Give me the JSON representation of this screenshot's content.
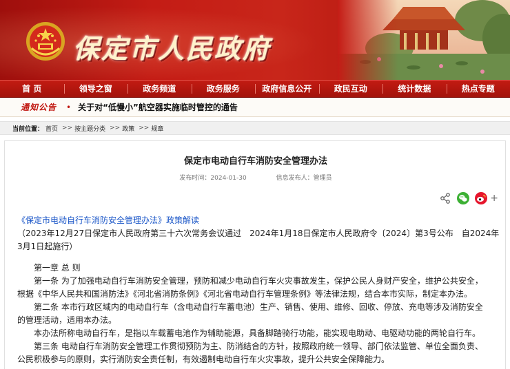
{
  "header": {
    "site_title": "保定市人民政府"
  },
  "nav": {
    "items": [
      "首 页",
      "领导之窗",
      "政务频道",
      "政务服务",
      "政府信息公开",
      "政民互动",
      "统计数据",
      "热点专题"
    ]
  },
  "notice": {
    "label": "通知公告",
    "dot": "•",
    "text": "关于对“低慢小”航空器实施临时管控的通告"
  },
  "breadcrumb": {
    "label": "当前位置：",
    "items": [
      "首页",
      "按主题分类",
      "政策",
      "规章"
    ],
    "separator": ">>"
  },
  "article": {
    "title": "保定市电动自行车消防安全管理办法",
    "publish_time": "发布时间：2024-01-30",
    "publisher": "信息发布人：管理员",
    "interpretation_link": "《保定市电动自行车消防安全管理办法》政策解读",
    "adoption_line1": "（2023年12月27日保定市人民政府第三十六次常务会议通过　2024年1月18日保定市人民政府令〔2024〕第3号公布　自2024年",
    "adoption_line2": "3月1日起施行）",
    "chapter1": "第一章 总 则",
    "art1_line1": "第一条  为了加强电动自行车消防安全管理，预防和减少电动自行车火灾事故发生，保护公民人身财产安全，维护公共安全，",
    "art1_line2": "根据《中华人民共和国消防法》《河北省消防条例》《河北省电动自行车管理条例》等法律法规，结合本市实际，制定本办法。",
    "art2_line1": "第二条  本市行政区域内的电动自行车（含电动自行车蓄电池）生产、销售、使用、维修、回收、停放、充电等涉及消防安全",
    "art2_line2": "的管理活动，适用本办法。",
    "art2_para2": "本办法所称电动自行车，是指以车载蓄电池作为辅助能源，具备脚踏骑行功能，能实现电助动、电驱动功能的两轮自行车。",
    "art3_line1": "第三条  电动自行车消防安全管理工作贯彻预防为主、防消结合的方针，按照政府统一领导、部门依法监管、单位全面负责、",
    "art3_line2": "公民积极参与的原则，实行消防安全责任制，有效遏制电动自行车火灾事故，提升公共安全保障能力。"
  },
  "share": {
    "plus": "+"
  },
  "colors": {
    "banner_red": "#c41c15",
    "link_blue": "#1a56c8",
    "wechat_green": "#3cb034",
    "weibo_red": "#e6162d"
  }
}
